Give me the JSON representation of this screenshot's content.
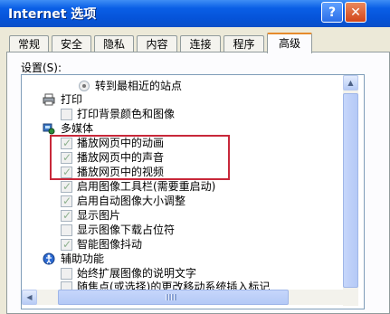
{
  "window": {
    "title": "Internet 选项",
    "help_label": "?",
    "close_label": "✕"
  },
  "tabs": [
    {
      "label": "常规"
    },
    {
      "label": "安全"
    },
    {
      "label": "隐私"
    },
    {
      "label": "内容"
    },
    {
      "label": "连接"
    },
    {
      "label": "程序"
    },
    {
      "label": "高级",
      "active": true
    }
  ],
  "settings": {
    "label": "设置(S):",
    "items": [
      {
        "kind": "radio",
        "label": "转到最相近的站点",
        "selected": false
      },
      {
        "kind": "category",
        "label": "打印",
        "icon": "printer-icon"
      },
      {
        "kind": "checkbox",
        "label": "打印背景颜色和图像",
        "checked": false
      },
      {
        "kind": "category",
        "label": "多媒体",
        "icon": "multimedia-icon"
      },
      {
        "kind": "checkbox",
        "label": "播放网页中的动画",
        "checked": true
      },
      {
        "kind": "checkbox",
        "label": "播放网页中的声音",
        "checked": true
      },
      {
        "kind": "checkbox",
        "label": "播放网页中的视频",
        "checked": true
      },
      {
        "kind": "checkbox",
        "label": "启用图像工具栏(需要重启动)",
        "checked": true
      },
      {
        "kind": "checkbox",
        "label": "启用自动图像大小调整",
        "checked": true
      },
      {
        "kind": "checkbox",
        "label": "显示图片",
        "checked": true
      },
      {
        "kind": "checkbox",
        "label": "显示图像下载占位符",
        "checked": false
      },
      {
        "kind": "checkbox",
        "label": "智能图像抖动",
        "checked": true
      },
      {
        "kind": "category",
        "label": "辅助功能",
        "icon": "accessibility-icon"
      },
      {
        "kind": "checkbox",
        "label": "始终扩展图像的说明文字",
        "checked": false
      },
      {
        "kind": "checkbox",
        "label": "随焦点(或选择)的更改移动系统插入标记",
        "checked": false
      }
    ]
  },
  "colors": {
    "highlight_box": "#c8283a",
    "title_bar": "#0553d8",
    "tab_active_accent": "#e68b2c"
  }
}
